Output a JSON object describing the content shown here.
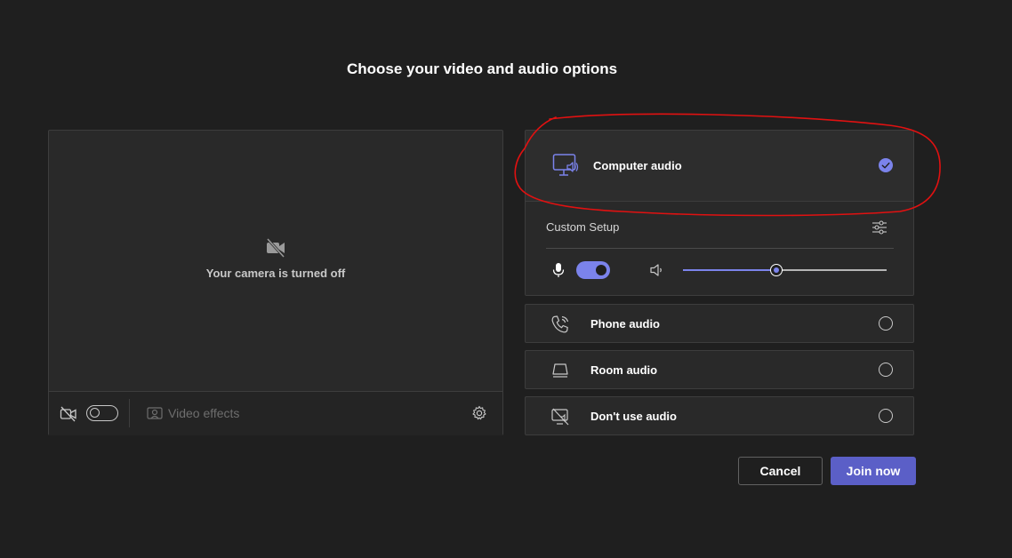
{
  "page": {
    "title": "Choose your video and audio options"
  },
  "video": {
    "camera_off_text": "Your camera is turned off",
    "camera_toggle_on": false,
    "effects_label": "Video effects",
    "icons": [
      "camera-off-icon",
      "video-effects-icon",
      "settings-gear-icon"
    ]
  },
  "audio": {
    "computer": {
      "label": "Computer audio",
      "selected": true,
      "icon": "computer-speaker-icon"
    },
    "custom_setup": {
      "label": "Custom Setup",
      "mic_toggle_on": true,
      "speaker_volume_percent": 46
    },
    "options": [
      {
        "label": "Phone audio",
        "selected": false,
        "icon": "phone-icon"
      },
      {
        "label": "Room audio",
        "selected": false,
        "icon": "room-display-icon"
      },
      {
        "label": "Don't use audio",
        "selected": false,
        "icon": "no-audio-icon"
      }
    ]
  },
  "actions": {
    "cancel_label": "Cancel",
    "join_label": "Join now"
  },
  "colors": {
    "background": "#1f1f1f",
    "accent": "#7b83eb",
    "join_button": "#5b5fc7",
    "annotation": "#e11111"
  }
}
